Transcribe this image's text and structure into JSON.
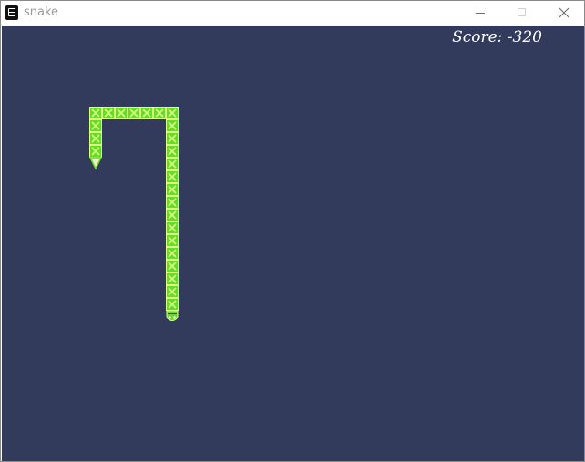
{
  "window": {
    "title": "snake"
  },
  "game": {
    "score_text": "Score: -320",
    "background_color": "#333b5c",
    "snake_color": "#66dd22",
    "snake_outline_color": "#d8ff88",
    "snake_length": 27,
    "head_direction": "down",
    "tail_direction": "down"
  }
}
